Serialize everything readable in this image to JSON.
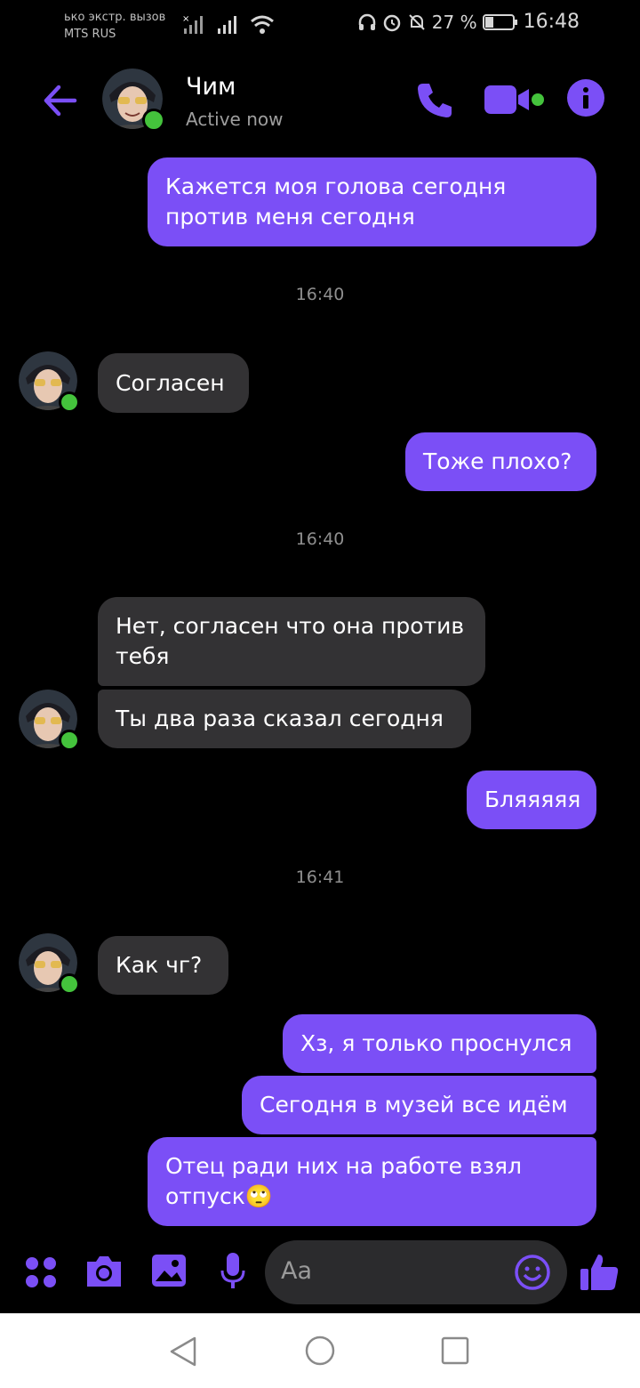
{
  "status_bar": {
    "carrier_line1": "ько экстр. вызов",
    "carrier_line2": "MTS RUS",
    "battery": "27 %",
    "time": "16:48"
  },
  "header": {
    "name": "Чим",
    "status": "Active now"
  },
  "messages": [
    {
      "dir": "out",
      "text": "Кажется моя голова сегодня против меня сегодня"
    },
    {
      "dir": "time",
      "text": "16:40"
    },
    {
      "dir": "in",
      "text": "Согласен"
    },
    {
      "dir": "out",
      "text": "Тоже плохо?"
    },
    {
      "dir": "time",
      "text": "16:40"
    },
    {
      "dir": "in",
      "text": "Нет, согласен что она против тебя"
    },
    {
      "dir": "in",
      "text": "Ты два раза сказал сегодня"
    },
    {
      "dir": "out",
      "text": "Бляяяяя"
    },
    {
      "dir": "time",
      "text": "16:41"
    },
    {
      "dir": "in",
      "text": "Как чг?"
    },
    {
      "dir": "out",
      "text": "Хз, я только проснулся"
    },
    {
      "dir": "out",
      "text": "Сегодня в музей все идём"
    },
    {
      "dir": "out",
      "text": "Отец ради них на работе взял отпуск🙄"
    }
  ],
  "composer": {
    "placeholder": "Aa"
  },
  "colors": {
    "accent": "#7b4ff6",
    "incoming_bubble": "#333234",
    "online": "#44c33c"
  }
}
